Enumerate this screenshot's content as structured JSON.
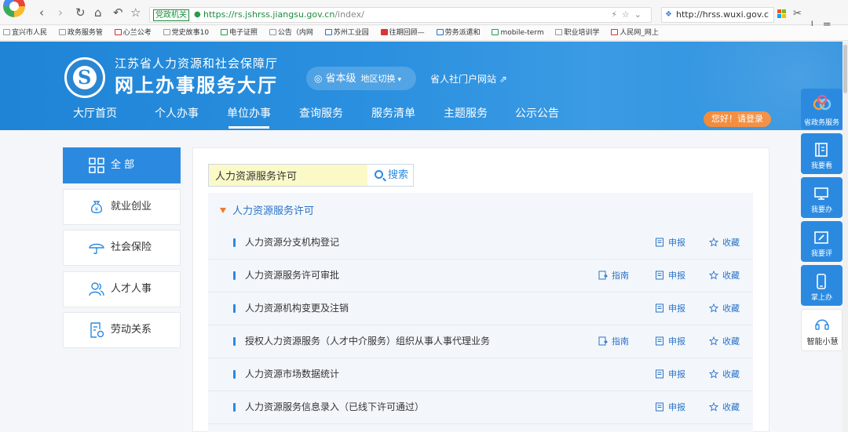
{
  "browser": {
    "address_badge": "党政机关",
    "url_host": "https://rs.jshrss.jiangsu.gov.cn",
    "url_path": "/index/",
    "side_address": "http://hrss.wuxi.gov.c",
    "bookmarks": [
      "宜兴市人民",
      "政务服务管",
      "心兰公考",
      "党史故事10",
      "电子证照",
      "公告（内网",
      "苏州工业园",
      "往期回顾—",
      "劳务派遣和",
      "mobile-term",
      "职业培训学",
      "人民网_网上"
    ]
  },
  "header": {
    "org_name": "江苏省人力资源和社会保障厅",
    "site_title": "网上办事服务大厅",
    "region": "省本级",
    "region_switch": "地区切换",
    "portal_link": "省人社门户网站",
    "nav": [
      "大厅首页",
      "个人办事",
      "单位办事",
      "查询服务",
      "服务清单",
      "主题服务",
      "公示公告"
    ],
    "active_nav": "单位办事",
    "login": "您好！请登录"
  },
  "categories": [
    {
      "label": "全 部",
      "icon": "grid-icon",
      "active": true
    },
    {
      "label": "就业创业",
      "icon": "money-bag-icon",
      "active": false
    },
    {
      "label": "社会保险",
      "icon": "umbrella-icon",
      "active": false
    },
    {
      "label": "人才人事",
      "icon": "people-icon",
      "active": false
    },
    {
      "label": "劳动关系",
      "icon": "document-settings-icon",
      "active": false
    }
  ],
  "search": {
    "value": "人力资源服务许可",
    "button": "搜索"
  },
  "results": {
    "group_title": "人力资源服务许可",
    "items": [
      {
        "name": "人力资源分支机构登记",
        "guide": null,
        "apply": "申报",
        "favorite": "收藏"
      },
      {
        "name": "人力资源服务许可审批",
        "guide": "指南",
        "apply": "申报",
        "favorite": "收藏"
      },
      {
        "name": "人力资源机构变更及注销",
        "guide": null,
        "apply": "申报",
        "favorite": "收藏"
      },
      {
        "name": "授权人力资源服务（人才中介服务）组织从事人事代理业务",
        "guide": "指南",
        "apply": "申报",
        "favorite": "收藏"
      },
      {
        "name": "人力资源市场数据统计",
        "guide": null,
        "apply": "申报",
        "favorite": "收藏"
      },
      {
        "name": "人力资源服务信息录入（已线下许可通过）",
        "guide": null,
        "apply": "申报",
        "favorite": "收藏"
      }
    ]
  },
  "float_toolbar": [
    {
      "label": "省政务服务",
      "icon": "gov-service-icon"
    },
    {
      "label": "我要看",
      "icon": "book-icon"
    },
    {
      "label": "我要办",
      "icon": "monitor-icon"
    },
    {
      "label": "我要评",
      "icon": "edit-icon"
    },
    {
      "label": "掌上办",
      "icon": "phone-icon"
    },
    {
      "label": "智能小慧",
      "icon": "headset-icon"
    }
  ],
  "colors": {
    "brand_blue": "#2b8ae0",
    "header_blue": "#1f84d6",
    "login_orange": "#f28a3a",
    "search_highlight": "#fbf9c8"
  }
}
